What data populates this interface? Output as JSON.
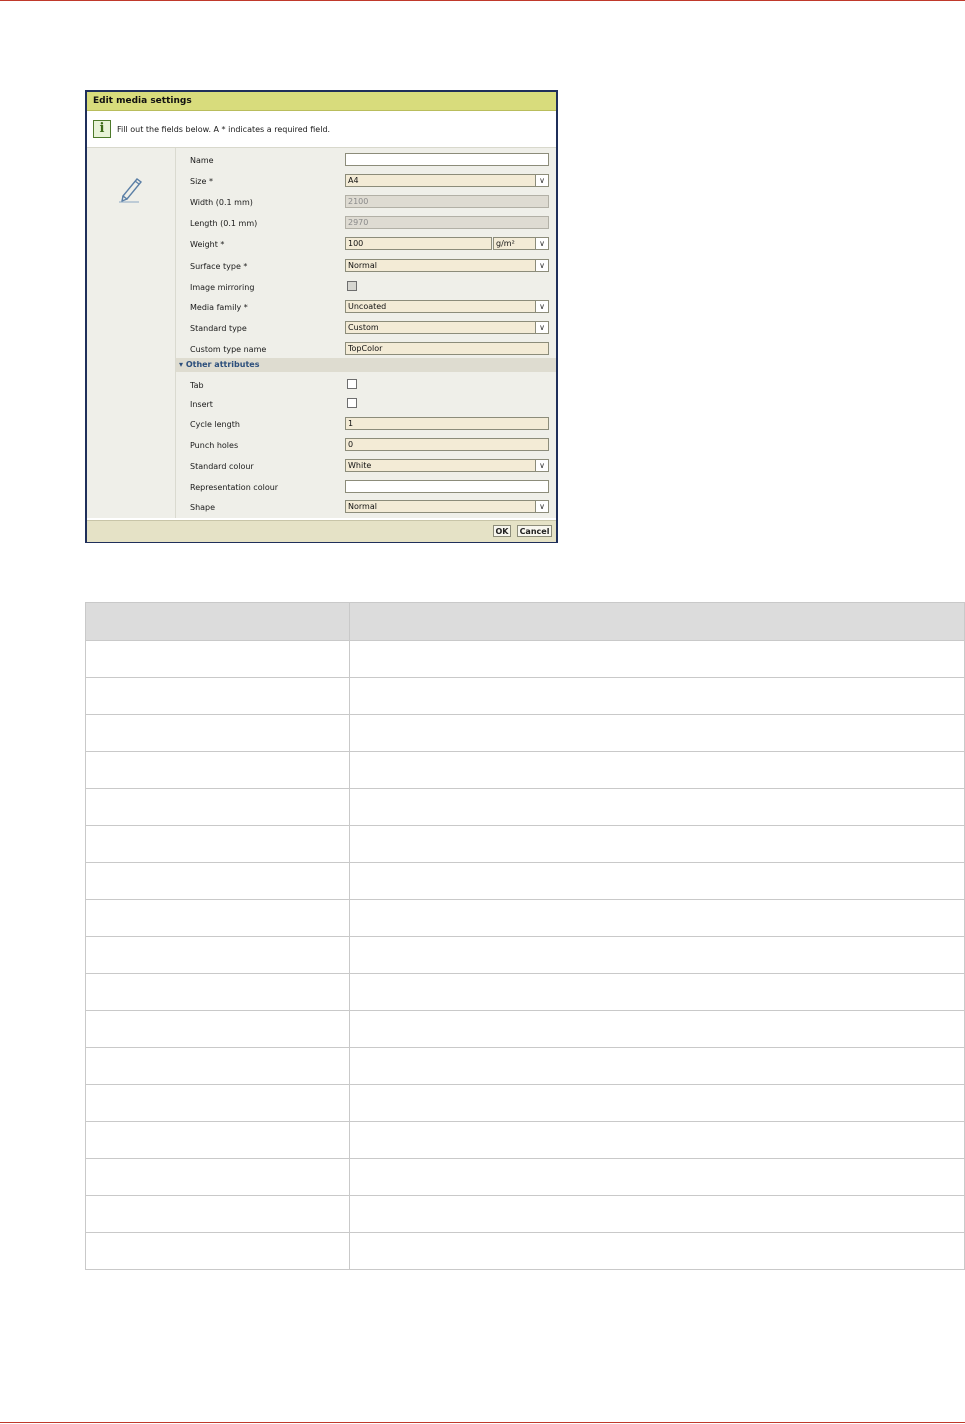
{
  "dialog": {
    "title": "Edit media settings",
    "info_text": "Fill out the fields below. A * indicates a required field.",
    "fields": {
      "name": {
        "label": "Name",
        "value": ""
      },
      "size": {
        "label": "Size *",
        "value": "A4"
      },
      "width": {
        "label": "Width (0.1 mm)",
        "value": "2100"
      },
      "length": {
        "label": "Length (0.1 mm)",
        "value": "2970"
      },
      "weight": {
        "label": "Weight *",
        "value": "100",
        "unit": "g/m²"
      },
      "surface_type": {
        "label": "Surface type *",
        "value": "Normal"
      },
      "image_mirroring": {
        "label": "Image mirroring",
        "checked": false
      },
      "media_family": {
        "label": "Media family *",
        "value": "Uncoated"
      },
      "standard_type": {
        "label": "Standard type",
        "value": "Custom"
      },
      "custom_type_name": {
        "label": "Custom type name",
        "value": "TopColor"
      }
    },
    "other_attributes": {
      "header": "Other attributes",
      "tab": {
        "label": "Tab",
        "checked": false
      },
      "insert": {
        "label": "Insert",
        "checked": false
      },
      "cycle_length": {
        "label": "Cycle length",
        "value": "1"
      },
      "punch_holes": {
        "label": "Punch holes",
        "value": "0"
      },
      "standard_colour": {
        "label": "Standard colour",
        "value": "White"
      },
      "representation_colour": {
        "label": "Representation colour",
        "value": ""
      },
      "shape": {
        "label": "Shape",
        "value": "Normal"
      }
    },
    "buttons": {
      "ok": "OK",
      "cancel": "Cancel"
    }
  },
  "table": {
    "header": [
      "",
      ""
    ],
    "row_count": 17
  },
  "colors": {
    "title_bar": "#d8dc7c",
    "dialog_border": "#1f2f5a",
    "field_bg": "#f3ebd6",
    "section_header_text": "#2c4f7c",
    "page_rule": "#c0392b"
  }
}
